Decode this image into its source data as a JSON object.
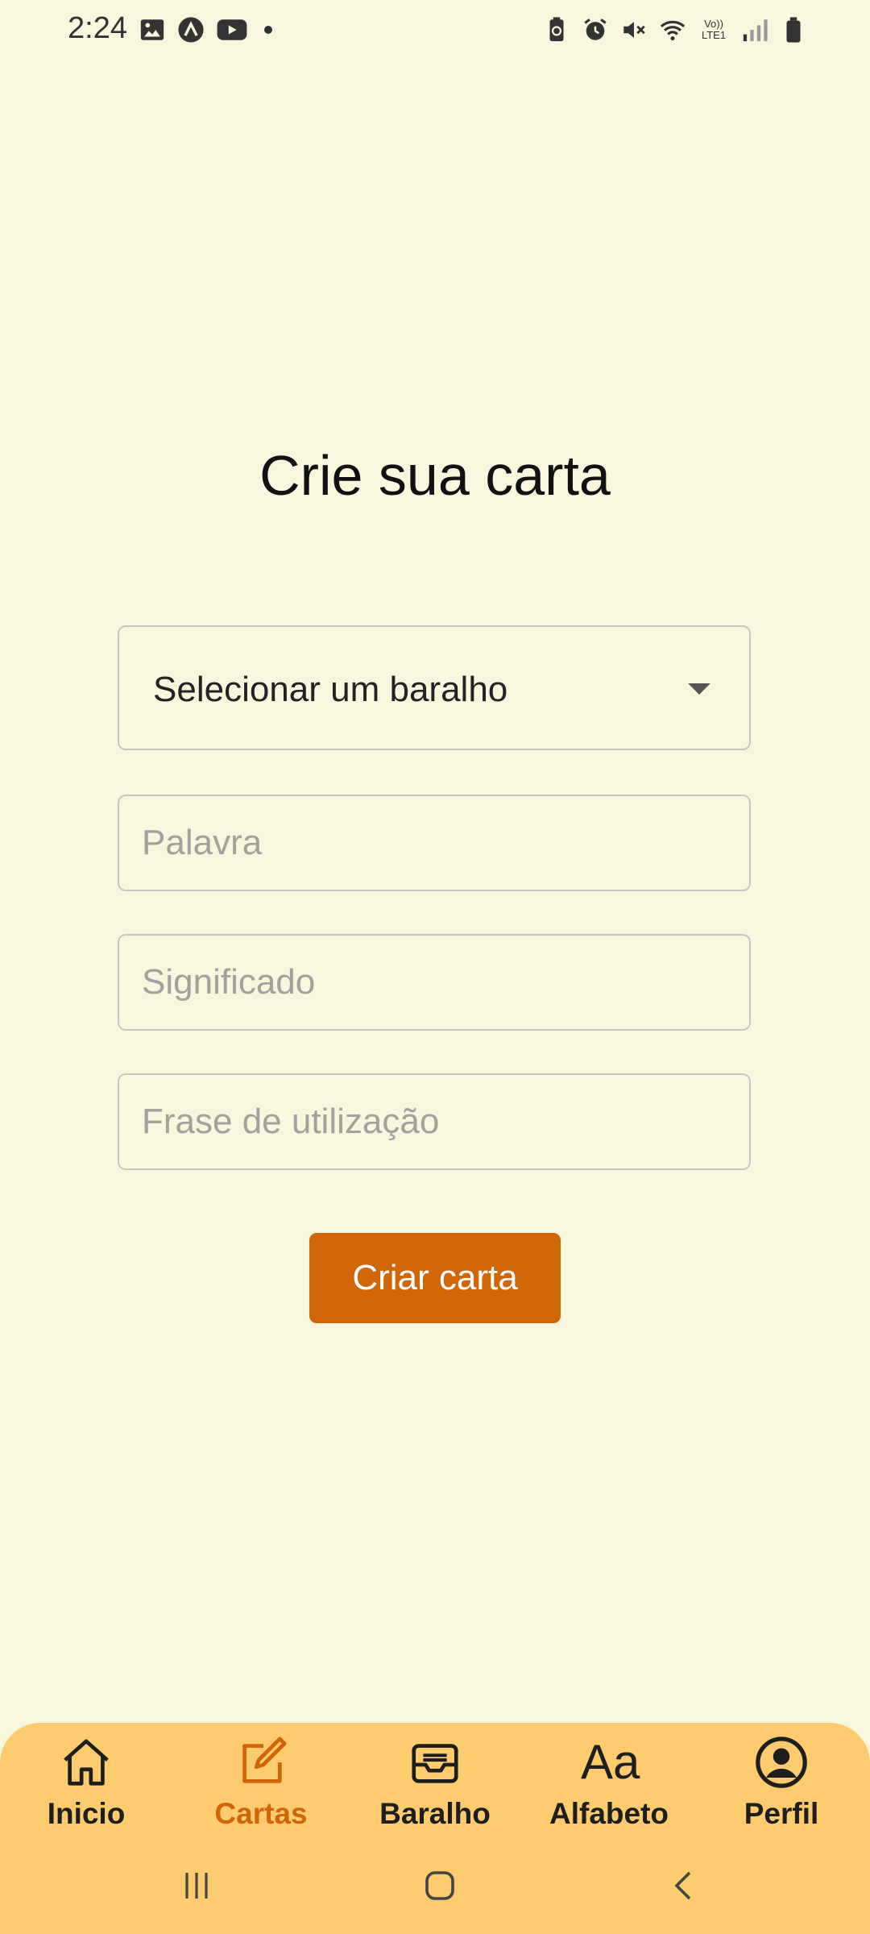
{
  "status_bar": {
    "time": "2:24",
    "left_icons": [
      "image-icon",
      "app-icon",
      "youtube-icon",
      "notification-dot"
    ],
    "right_icons": [
      "battery-saver-icon",
      "alarm-icon",
      "mute-icon",
      "wifi-icon",
      "volte-icon",
      "signal-icon",
      "battery-icon"
    ],
    "volte_text": "Vo)) LTE1"
  },
  "page": {
    "title": "Crie sua carta"
  },
  "form": {
    "deck_select": {
      "value": "Selecionar um baralho"
    },
    "word_field": {
      "placeholder": "Palavra",
      "value": ""
    },
    "meaning_field": {
      "placeholder": "Significado",
      "value": ""
    },
    "sentence_field": {
      "placeholder": "Frase de utilização",
      "value": ""
    },
    "submit_label": "Criar carta"
  },
  "bottom_nav": {
    "items": [
      {
        "label": "Inicio",
        "icon": "home-icon",
        "active": false
      },
      {
        "label": "Cartas",
        "icon": "edit-icon",
        "active": true
      },
      {
        "label": "Baralho",
        "icon": "inbox-icon",
        "active": false
      },
      {
        "label": "Alfabeto",
        "icon": "font-icon",
        "icon_text": "Aa",
        "active": false
      },
      {
        "label": "Perfil",
        "icon": "account-icon",
        "active": false
      }
    ]
  },
  "colors": {
    "background": "#f9f6de",
    "accent": "#d06605",
    "nav_background": "#fecc6e"
  },
  "system_nav": [
    "recents-button",
    "home-button",
    "back-button"
  ]
}
